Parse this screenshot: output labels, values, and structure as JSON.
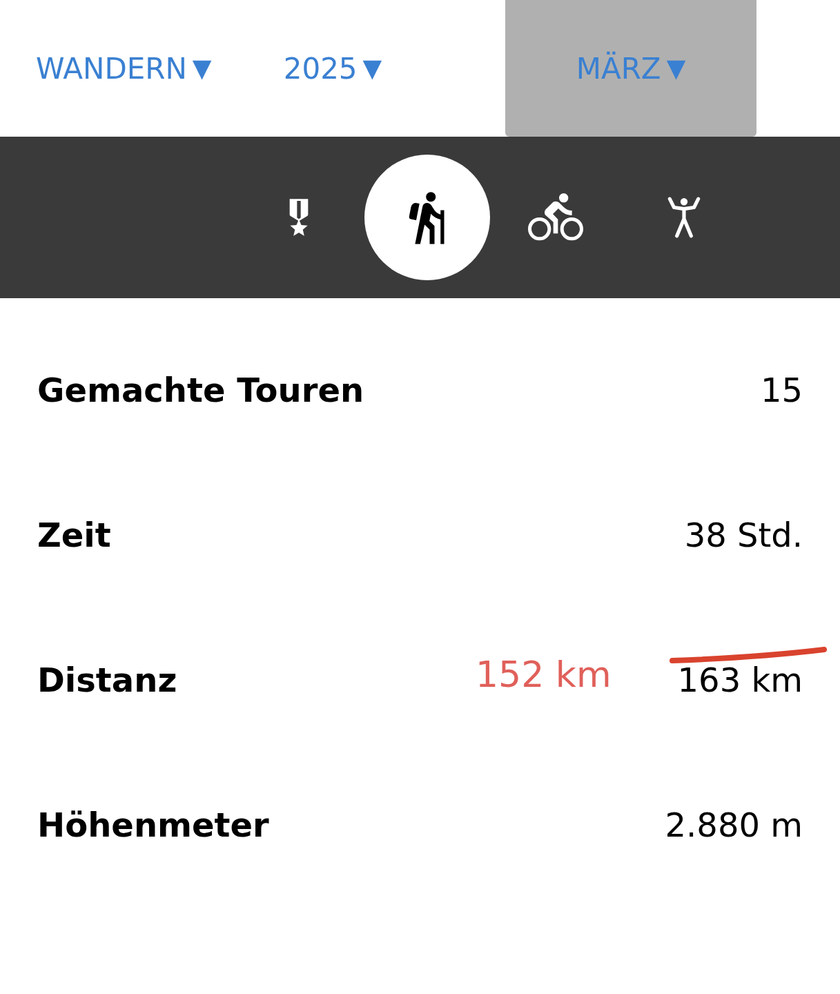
{
  "filters": [
    {
      "label": "WANDERN",
      "caret": "▼",
      "selected": false
    },
    {
      "label": "2025",
      "caret": "▼",
      "selected": false
    },
    {
      "label": "MÄRZ",
      "caret": "▼",
      "selected": true
    }
  ],
  "activity_tabs": [
    {
      "kind": "medal",
      "selected": false
    },
    {
      "kind": "hiking",
      "selected": true
    },
    {
      "kind": "bike",
      "selected": false
    },
    {
      "kind": "fitness",
      "selected": false
    }
  ],
  "stats": [
    {
      "label": "Gemachte Touren",
      "value": "15",
      "struck": false
    },
    {
      "label": "Zeit",
      "value": "38 Std.",
      "struck": false
    },
    {
      "label": "Distanz",
      "value": "163 km",
      "struck": true,
      "correction": "152 km"
    },
    {
      "label": "Höhenmeter",
      "value": "2.880 m",
      "struck": false
    }
  ]
}
